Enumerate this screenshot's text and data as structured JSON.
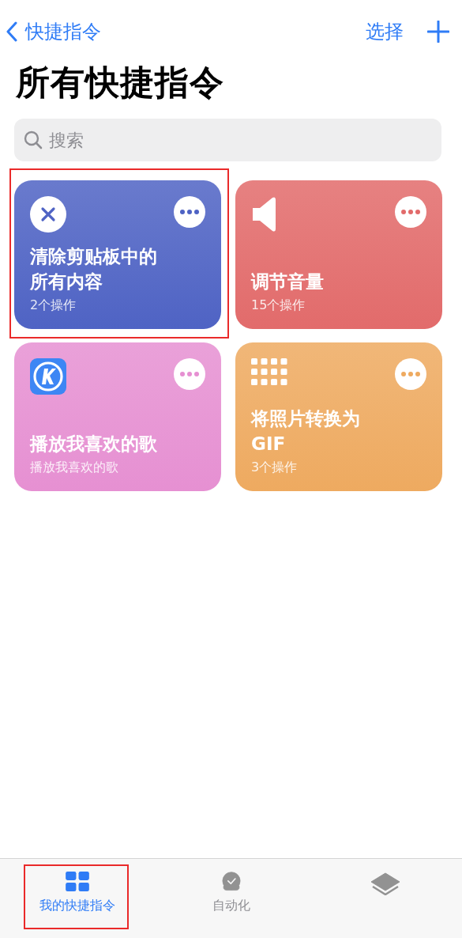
{
  "nav": {
    "back_label": "快捷指令",
    "select_label": "选择"
  },
  "title": "所有快捷指令",
  "search": {
    "placeholder": "搜索"
  },
  "shortcuts": [
    {
      "kind": "close",
      "title": "清除剪贴板中的所有内容",
      "subtitle": "2个操作",
      "color": "#4f63c4",
      "highlighted": true
    },
    {
      "kind": "speaker",
      "title": "调节音量",
      "subtitle": "15个操作",
      "color": "#e26b6b",
      "highlighted": false
    },
    {
      "kind": "app",
      "title": "播放我喜欢的歌",
      "subtitle": "播放我喜欢的歌",
      "color": "#e690d2",
      "highlighted": false
    },
    {
      "kind": "grid",
      "title": "将照片转换为 GIF",
      "subtitle": "3个操作",
      "color": "#eeaa60",
      "highlighted": false
    }
  ],
  "tabs": [
    {
      "kind": "grid",
      "label": "我的快捷指令",
      "selected": true,
      "highlighted": true
    },
    {
      "kind": "clock",
      "label": "自动化",
      "selected": false,
      "highlighted": false
    },
    {
      "kind": "layers",
      "selected": false,
      "highlighted": false
    }
  ]
}
